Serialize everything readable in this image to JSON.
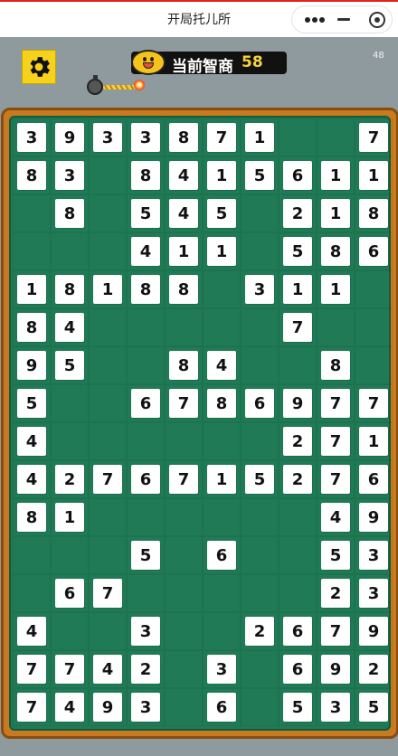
{
  "window": {
    "title": "开局托儿所"
  },
  "header": {
    "iq_label": "当前智商",
    "iq_value": "58",
    "fps": "48"
  },
  "colors": {
    "board": "#1f7a55",
    "frame": "#c77a1f",
    "tile": "#ffffff",
    "iq_value": "#f7d23a",
    "settings_button": "#f6d31a"
  },
  "icons": {
    "settings": "gear-icon",
    "mascot": "mascot-face-icon",
    "timer": "bomb-fuse-icon",
    "more": "more-dots-icon",
    "minimize": "minimize-icon",
    "close": "target-close-icon"
  },
  "board": {
    "rows": [
      [
        "3",
        "9",
        "3",
        "3",
        "8",
        "7",
        "1",
        "",
        "",
        "7"
      ],
      [
        "8",
        "3",
        "",
        "8",
        "4",
        "1",
        "5",
        "6",
        "1",
        "1"
      ],
      [
        "",
        "8",
        "",
        "5",
        "4",
        "5",
        "",
        "2",
        "1",
        "8"
      ],
      [
        "",
        "",
        "",
        "4",
        "1",
        "1",
        "",
        "5",
        "8",
        "6"
      ],
      [
        "1",
        "8",
        "1",
        "8",
        "8",
        "",
        "3",
        "1",
        "1",
        ""
      ],
      [
        "8",
        "4",
        "",
        "",
        "",
        "",
        "",
        "7",
        "",
        ""
      ],
      [
        "9",
        "5",
        "",
        "",
        "8",
        "4",
        "",
        "",
        "8",
        ""
      ],
      [
        "5",
        "",
        "",
        "6",
        "7",
        "8",
        "6",
        "9",
        "7",
        "7"
      ],
      [
        "4",
        "",
        "",
        "",
        "",
        "",
        "",
        "2",
        "7",
        "1"
      ],
      [
        "4",
        "2",
        "7",
        "6",
        "7",
        "1",
        "5",
        "2",
        "7",
        "6"
      ],
      [
        "8",
        "1",
        "",
        "",
        "",
        "",
        "",
        "",
        "4",
        "9"
      ],
      [
        "",
        "",
        "",
        "5",
        "",
        "6",
        "",
        "",
        "5",
        "3"
      ],
      [
        "",
        "6",
        "7",
        "",
        "",
        "",
        "",
        "",
        "2",
        "3"
      ],
      [
        "4",
        "",
        "",
        "3",
        "",
        "",
        "2",
        "6",
        "7",
        "9"
      ],
      [
        "7",
        "7",
        "4",
        "2",
        "",
        "3",
        "",
        "6",
        "9",
        "2"
      ],
      [
        "7",
        "4",
        "9",
        "3",
        "",
        "6",
        "",
        "5",
        "3",
        "5"
      ]
    ]
  }
}
